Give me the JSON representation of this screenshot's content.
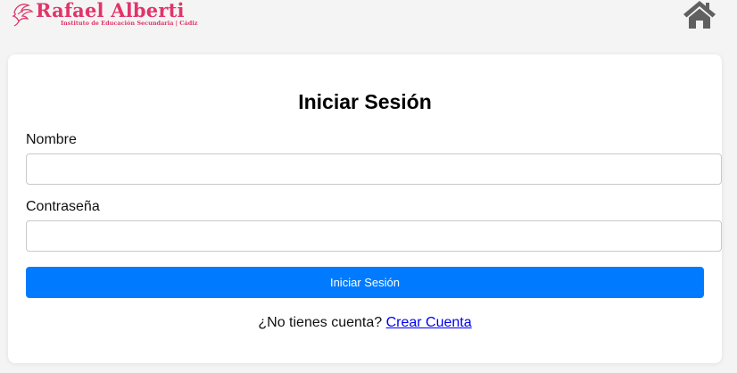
{
  "header": {
    "logo_name": "Rafael Alberti",
    "logo_subtitle": "Instituto de Educación Secundaria | Cádiz",
    "brand_color": "#e0356a",
    "home_icon": "home-icon"
  },
  "login": {
    "title": "Iniciar Sesión",
    "name_label": "Nombre",
    "name_value": "",
    "password_label": "Contraseña",
    "password_value": "",
    "submit_label": "Iniciar Sesión",
    "no_account_text": "¿No tienes cuenta?",
    "create_account_link": "Crear Cuenta",
    "button_color": "#007bff",
    "link_color": "#0000ee"
  }
}
